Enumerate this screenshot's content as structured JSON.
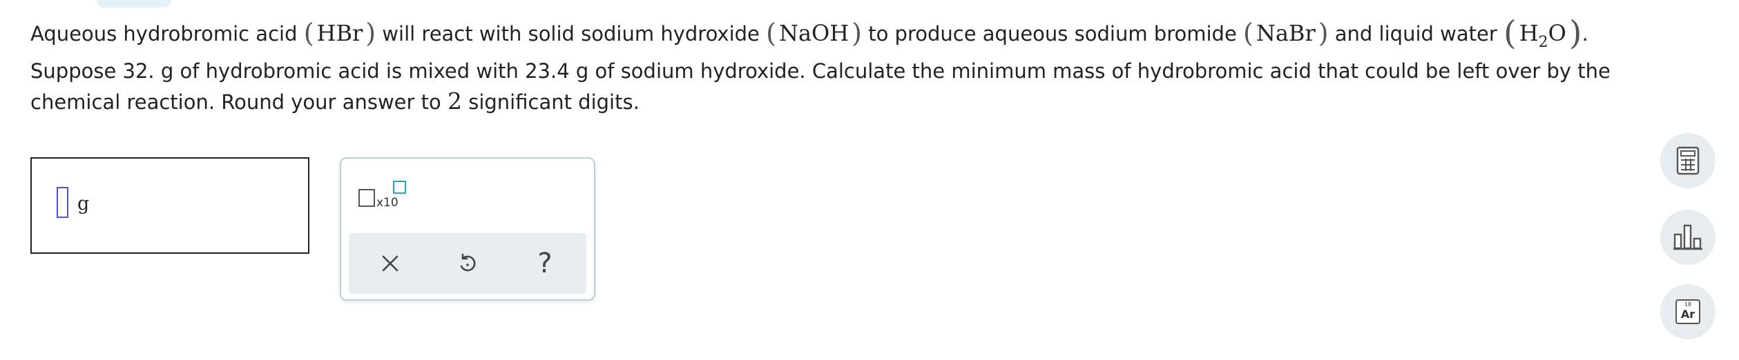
{
  "question": {
    "line1": {
      "t1": "Aqueous hydrobromic acid",
      "f1": "HBr",
      "t2": "will react with solid sodium hydroxide",
      "f2": "NaOH",
      "t3": "to produce aqueous sodium bromide",
      "f3": "NaBr",
      "t4": "and liquid water",
      "f4_h": "H",
      "f4_sub": "2",
      "f4_o": "O",
      "end": "."
    },
    "line2": {
      "t1": "Suppose 32. g of hydrobromic acid is mixed with 23.4 g of sodium hydroxide. Calculate the minimum mass of hydrobromic acid that could be left over by the chemical reaction. Round your answer to",
      "digits": "2",
      "t2": "significant digits."
    }
  },
  "answer": {
    "value": "",
    "unit": "g"
  },
  "keypad": {
    "sci_label": "x10",
    "help_label": "?"
  },
  "tools": {
    "periodic_number": "18",
    "periodic_symbol": "Ar"
  },
  "colors": {
    "input_border": "#4a50e8",
    "exponent_box": "#2aa0c4",
    "panel_bg": "#e6ecef",
    "keypad_border": "#b9cfd8"
  },
  "icons": [
    "scientific-notation-icon",
    "clear-x-icon",
    "undo-icon",
    "help-icon",
    "calculator-icon",
    "data-chart-icon",
    "periodic-table-icon"
  ]
}
